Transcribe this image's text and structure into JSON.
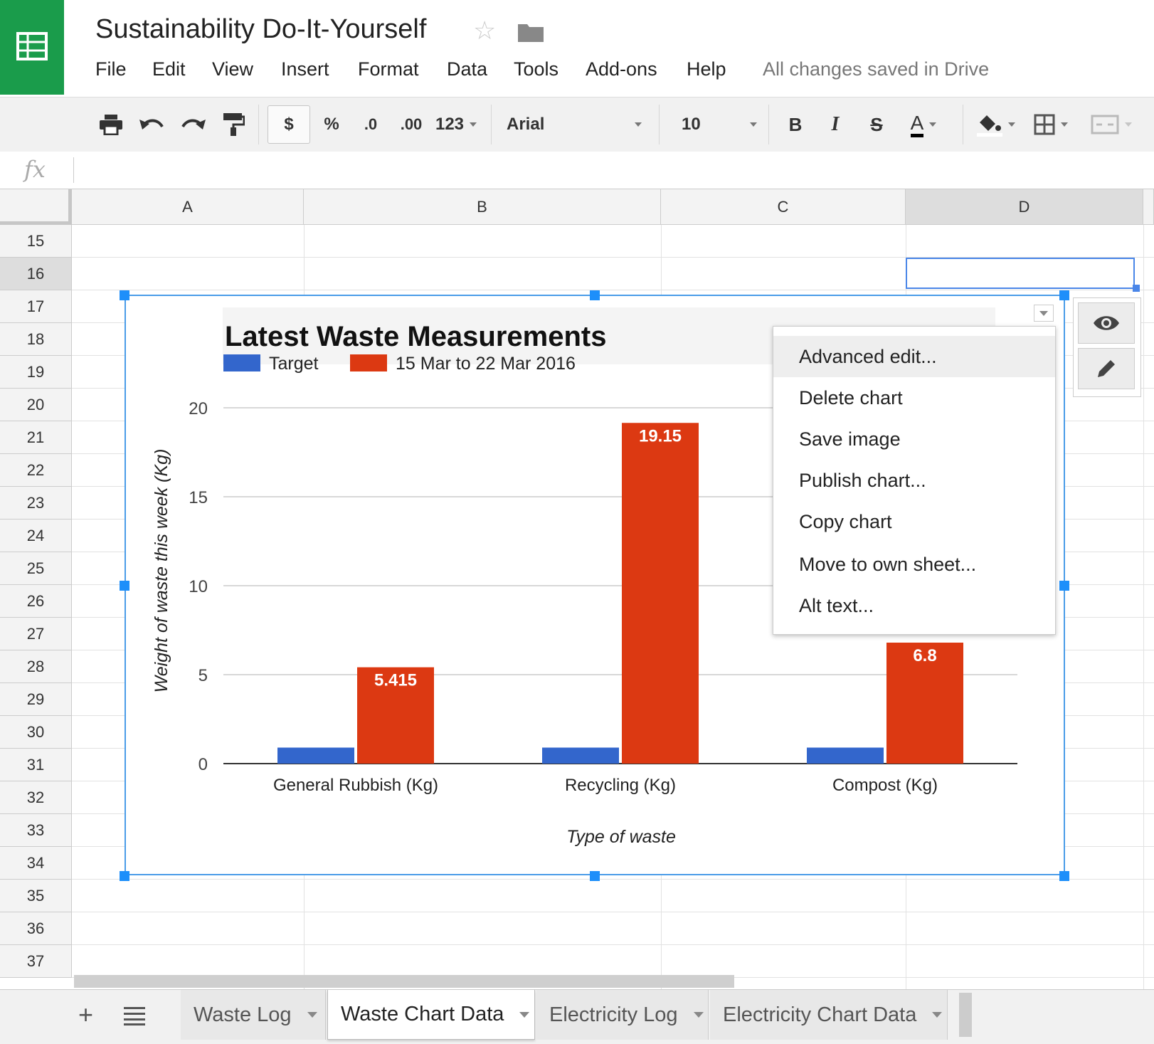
{
  "app": {
    "doc_title": "Sustainability Do-It-Yourself",
    "save_status": "All changes saved in Drive",
    "brand_color": "#1a9c4b"
  },
  "menu": [
    "File",
    "Edit",
    "View",
    "Insert",
    "Format",
    "Data",
    "Tools",
    "Add-ons",
    "Help"
  ],
  "toolbar": {
    "currency": "$",
    "percent": "%",
    "decrease_decimal": ".0",
    "increase_decimal": ".00",
    "more_formats": "123",
    "font": "Arial",
    "font_size": "10",
    "bold": "B",
    "italic": "I",
    "strike": "S",
    "text_color": "A"
  },
  "formula": {
    "fx": "fx",
    "value": ""
  },
  "grid": {
    "columns": [
      "A",
      "B",
      "C",
      "D"
    ],
    "selected_column": "D",
    "rows": [
      "15",
      "16",
      "17",
      "18",
      "19",
      "20",
      "21",
      "22",
      "23",
      "24",
      "25",
      "26",
      "27",
      "28",
      "29",
      "30",
      "31",
      "32",
      "33",
      "34",
      "35",
      "36",
      "37"
    ],
    "selected_row": "16"
  },
  "chart_data": {
    "type": "bar",
    "title": "Latest Waste Measurements",
    "xlabel": "Type of waste",
    "ylabel": "Weight of waste this week (Kg)",
    "categories": [
      "General Rubbish (Kg)",
      "Recycling (Kg)",
      "Compost (Kg)"
    ],
    "series": [
      {
        "name": "Target",
        "values": [
          0.9,
          0.9,
          0.9
        ],
        "color": "#3366cc"
      },
      {
        "name": "15 Mar to 22 Mar 2016",
        "values": [
          5.415,
          19.15,
          6.8
        ],
        "color": "#dc3912",
        "data_labels": [
          "5.415",
          "19.15",
          "6.8"
        ]
      }
    ],
    "ylim": [
      0,
      20
    ],
    "yticks": [
      "0",
      "5",
      "10",
      "15",
      "20"
    ],
    "grid": true,
    "legend": "top-left"
  },
  "context_menu": {
    "items": [
      "Advanced edit...",
      "Delete chart",
      "Save image",
      "Publish chart...",
      "Copy chart",
      "Move to own sheet...",
      "Alt text..."
    ],
    "highlighted": "Advanced edit..."
  },
  "sheet_tabs": {
    "tabs": [
      "Waste Log",
      "Waste Chart Data",
      "Electricity Log",
      "Electricity Chart Data"
    ],
    "active": "Waste Chart Data"
  }
}
